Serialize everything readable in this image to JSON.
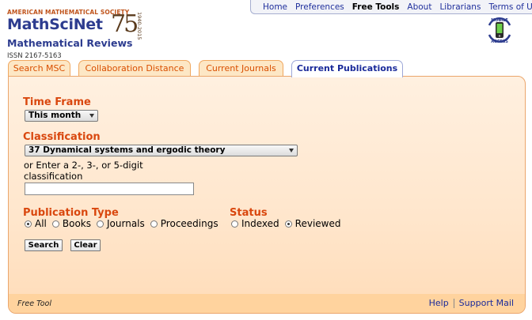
{
  "header": {
    "society": "AMERICAN MATHEMATICAL SOCIETY",
    "brand": "MathSciNet",
    "subtitle": "Mathematical Reviews",
    "issn": "ISSN 2167-5163",
    "anniversary": "75",
    "years": "1940-2015",
    "mobile_text": "MOBILE ACCESS"
  },
  "topnav": {
    "items": [
      {
        "label": "Home",
        "active": false
      },
      {
        "label": "Preferences",
        "active": false
      },
      {
        "label": "Free Tools",
        "active": true
      },
      {
        "label": "About",
        "active": false
      },
      {
        "label": "Librarians",
        "active": false
      },
      {
        "label": "Terms of Use",
        "active": false
      }
    ]
  },
  "tabs": [
    {
      "label": "Search MSC",
      "active": false
    },
    {
      "label": "Collaboration Distance",
      "active": false
    },
    {
      "label": "Current Journals",
      "active": false
    },
    {
      "label": "Current Publications",
      "active": true
    }
  ],
  "form": {
    "time_frame": {
      "title": "Time Frame",
      "selected": "This month"
    },
    "classification": {
      "title": "Classification",
      "selected": "37 Dynamical systems and ergodic theory",
      "hint_line1": "or Enter a 2-, 3-, or 5-digit",
      "hint_line2": "classification",
      "input_value": ""
    },
    "publication_type": {
      "title": "Publication Type",
      "options": [
        {
          "label": "All",
          "checked": true
        },
        {
          "label": "Books",
          "checked": false
        },
        {
          "label": "Journals",
          "checked": false
        },
        {
          "label": "Proceedings",
          "checked": false
        }
      ]
    },
    "status": {
      "title": "Status",
      "options": [
        {
          "label": "Indexed",
          "checked": false
        },
        {
          "label": "Reviewed",
          "checked": true
        }
      ]
    },
    "search_label": "Search",
    "clear_label": "Clear"
  },
  "footer": {
    "free_tool": "Free Tool",
    "help": "Help",
    "support": "Support Mail"
  },
  "colors": {
    "accent": "#d9470e",
    "link": "#1a2a9a",
    "brand": "#2d3c8f"
  }
}
